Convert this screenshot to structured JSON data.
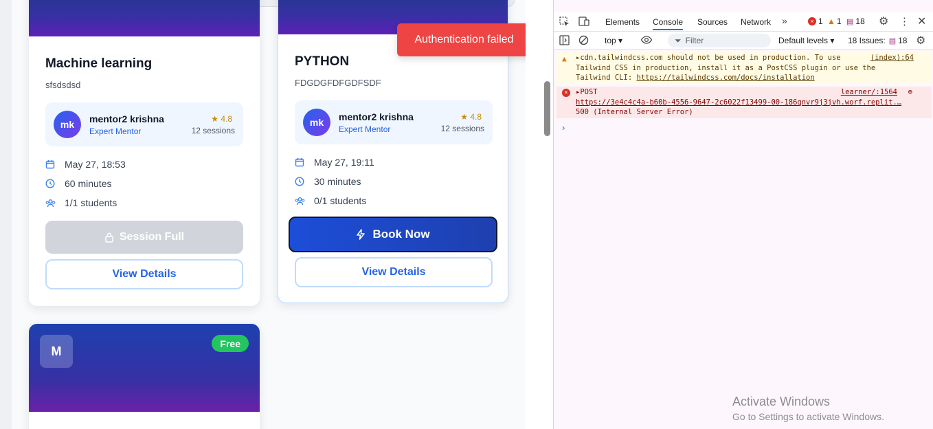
{
  "toast": {
    "text": "Authentication failed"
  },
  "cards": {
    "card1": {
      "title": "Machine learning",
      "description": "sfsdsdsd",
      "mentor_initials": "mk",
      "mentor_name": "mentor2 krishna",
      "mentor_role": "Expert Mentor",
      "rating": "4.8",
      "sessions": "12 sessions",
      "date": "May 27, 18:53",
      "duration": "60 minutes",
      "students": "1/1 students",
      "primary_button": "Session Full",
      "details_button": "View Details"
    },
    "card2": {
      "title": "PYTHON",
      "description": "FDGDGFDFGDFSDF",
      "mentor_initials": "mk",
      "mentor_name": "mentor2 krishna",
      "mentor_role": "Expert Mentor",
      "rating": "4.8",
      "sessions": "12 sessions",
      "date": "May 27, 19:11",
      "duration": "30 minutes",
      "students": "0/1 students",
      "primary_button": "Book Now",
      "details_button": "View Details"
    },
    "card3": {
      "initial": "M",
      "badge": "Free"
    }
  },
  "devtools": {
    "tabs": [
      "Elements",
      "Console",
      "Sources",
      "Network"
    ],
    "active_tab": "Console",
    "error_count": "1",
    "warning_count": "1",
    "info_count": "18",
    "context": "top",
    "filter_placeholder": "Filter",
    "levels": "Default levels",
    "issues_label": "18 Issues:",
    "issues_count": "18",
    "warn_line1": "cdn.tailwindcss.com should not be used in production. To use",
    "warn_line2": "Tailwind CSS in production, install it as a PostCSS plugin or use the",
    "warn_line3_prefix": "Tailwind CLI: ",
    "warn_link": "https://tailwindcss.com/docs/installation",
    "warn_source": "(index):64",
    "err_method": "POST",
    "err_url": "https://3e4c4c4a-b60b-4556-9647-2c6022f13499-00-186qnvr9j3jvh.worf.replit.…",
    "err_status": "500 (Internal Server Error)",
    "err_source": "learner/:1564"
  },
  "watermark": {
    "title": "Activate Windows",
    "subtitle": "Go to Settings to activate Windows."
  },
  "colors": {
    "primary": "#1d4ed8",
    "toast": "#ef4444",
    "free_badge": "#22c55e",
    "disabled": "#d1d5db"
  }
}
